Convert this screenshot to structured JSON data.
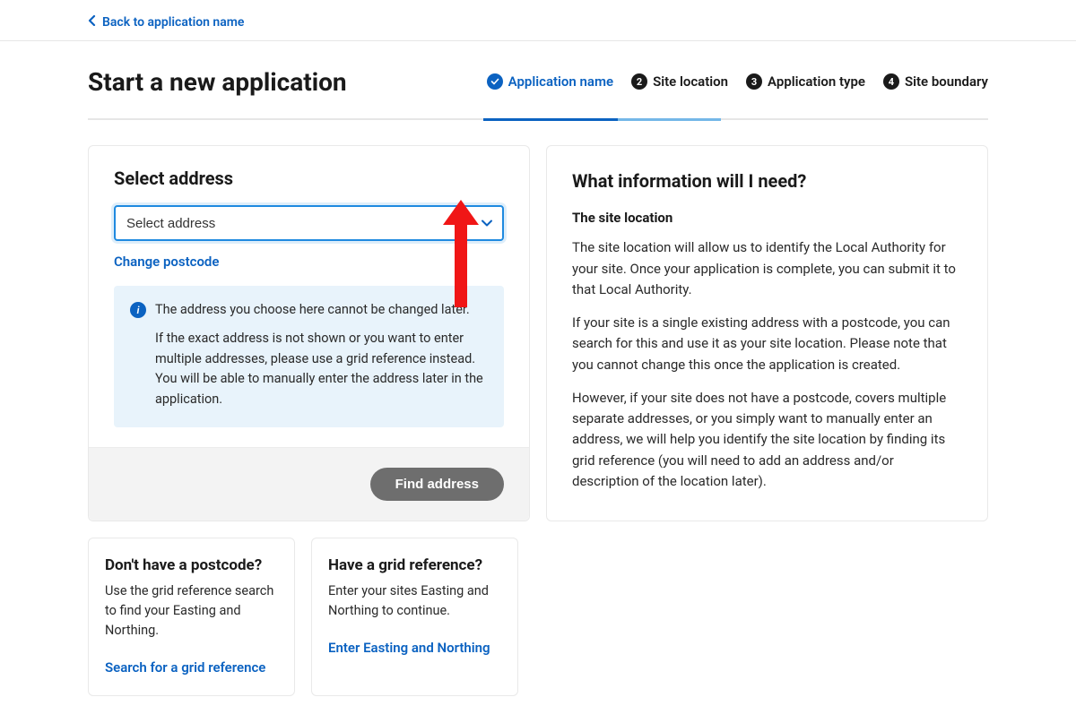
{
  "back_link": "Back to application name",
  "title": "Start a new application",
  "steps": [
    {
      "label": "Application name",
      "badge": "✓",
      "state": "done"
    },
    {
      "label": "Site location",
      "badge": "2",
      "state": "active"
    },
    {
      "label": "Application type",
      "badge": "3",
      "state": ""
    },
    {
      "label": "Site boundary",
      "badge": "4",
      "state": ""
    }
  ],
  "address_card": {
    "heading": "Select address",
    "select_placeholder": "Select address",
    "change_postcode": "Change postcode",
    "info_line1": "The address you choose here cannot be changed later.",
    "info_line2": "If the exact address is not shown or you want to enter multiple addresses, please use a grid reference instead. You will be able to manually enter the address later in the application.",
    "button": "Find address"
  },
  "info_card": {
    "heading": "What information will I need?",
    "sub": "The site location",
    "p1": "The site location will allow us to identify the Local Authority for your site. Once your application is complete, you can submit it to that Local Authority.",
    "p2": "If your site is a single existing address with a postcode, you can search for this and use it as your site location. Please note that you cannot change this once the application is created.",
    "p3": "However, if your site does not have a postcode, covers multiple separate addresses, or you simply want to manually enter an address, we will help you identify the site location by finding its grid reference (you will need to add an address and/or description of the location later)."
  },
  "mini": [
    {
      "heading": "Don't have a postcode?",
      "body": "Use the grid reference search to find your Easting and Northing.",
      "link": "Search for a grid reference"
    },
    {
      "heading": "Have a grid reference?",
      "body": "Enter your sites Easting and Northing to continue.",
      "link": "Enter Easting and Northing"
    }
  ]
}
